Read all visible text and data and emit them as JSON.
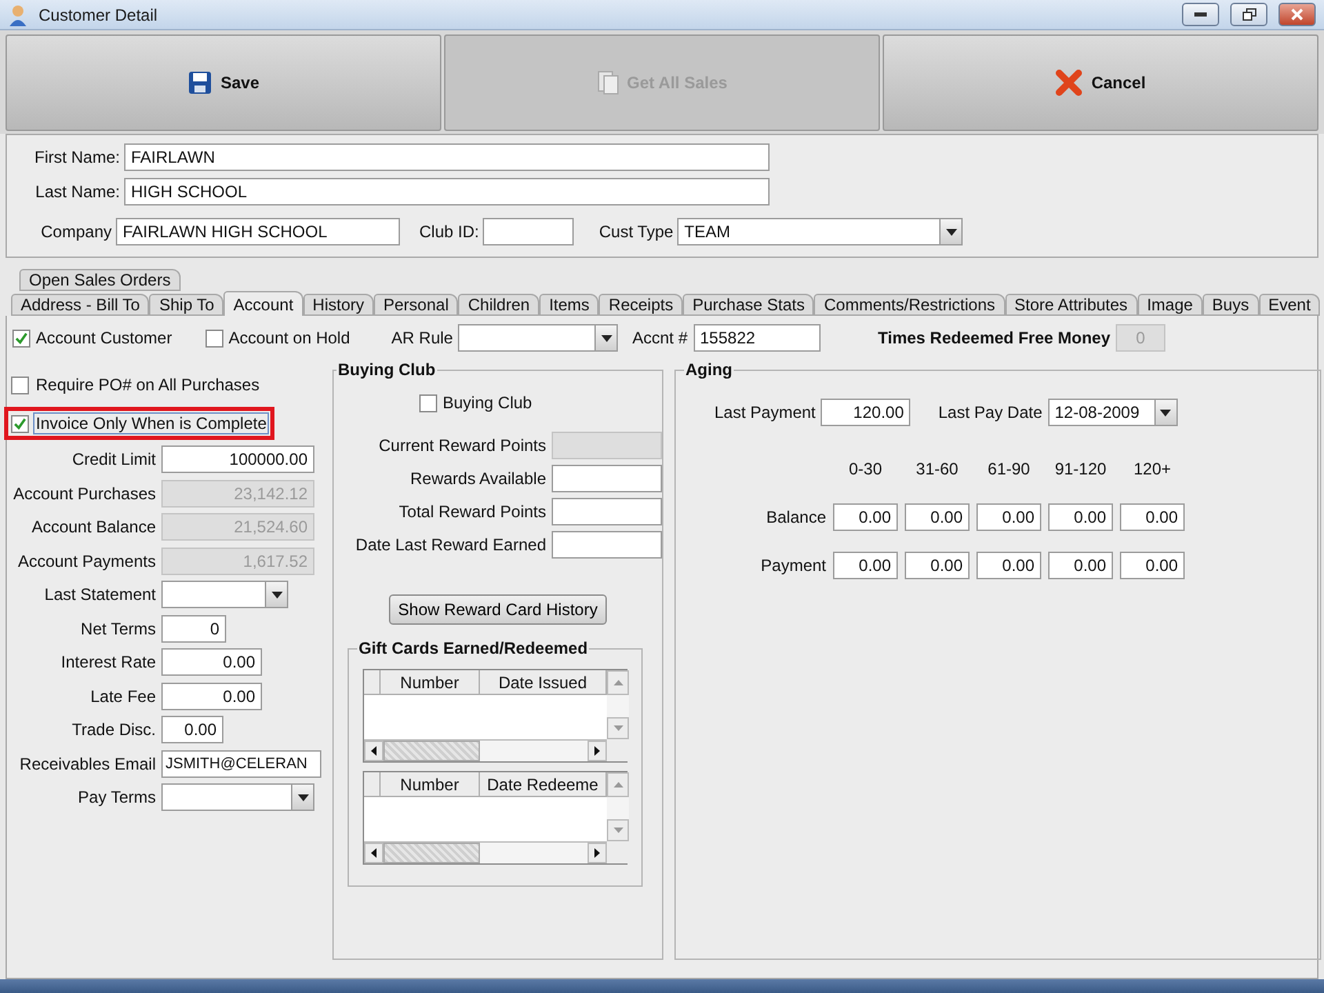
{
  "window": {
    "title": "Customer Detail"
  },
  "toolbar": [
    {
      "label": "Save",
      "disabled": false
    },
    {
      "label": "Get All Sales",
      "disabled": true
    },
    {
      "label": "Cancel",
      "disabled": false
    }
  ],
  "customer": {
    "first_name": {
      "label": "First Name:",
      "value": "FAIRLAWN"
    },
    "last_name": {
      "label": "Last Name:",
      "value": "HIGH SCHOOL"
    },
    "company": {
      "label": "Company",
      "value": "FAIRLAWN HIGH SCHOOL"
    },
    "club_id": {
      "label": "Club ID:"
    },
    "cust_type": {
      "label": "Cust Type",
      "value": "TEAM"
    }
  },
  "tabs": [
    [
      {
        "label": "Open Sales Orders",
        "selected": false
      }
    ],
    [
      {
        "label": "Address - Bill To",
        "selected": false
      },
      {
        "label": "Ship To",
        "selected": false
      },
      {
        "label": "Account",
        "selected": true
      },
      {
        "label": "History",
        "selected": false
      },
      {
        "label": "Personal",
        "selected": false
      },
      {
        "label": "Children",
        "selected": false
      },
      {
        "label": "Items",
        "selected": false
      },
      {
        "label": "Receipts",
        "selected": false
      },
      {
        "label": "Purchase Stats",
        "selected": false
      },
      {
        "label": "Comments/Restrictions",
        "selected": false
      },
      {
        "label": "Store Attributes",
        "selected": false
      },
      {
        "label": "Image",
        "selected": false
      },
      {
        "label": "Buys",
        "selected": false
      },
      {
        "label": "Event",
        "selected": false
      }
    ]
  ],
  "account": {
    "account_customer": {
      "label": "Account Customer",
      "checked": true
    },
    "account_on_hold": {
      "label": "Account on Hold",
      "checked": false
    },
    "ar_rule": {
      "label": "AR Rule"
    },
    "accnt_no": {
      "label": "Accnt #",
      "value": "155822"
    },
    "times_redeemed": {
      "label": "Times Redeemed Free Money",
      "value": "0",
      "disabled": true
    },
    "options": [
      {
        "label": "Require PO# on All Purchases",
        "checked": false,
        "highlighted": false
      },
      {
        "label": "Invoice Only  When is Complete",
        "checked": true,
        "highlighted": true
      }
    ],
    "fields": [
      {
        "label": "Credit Limit",
        "kind": "number",
        "value": "100000.00",
        "disabled": false
      },
      {
        "label": "Account Purchases",
        "kind": "number",
        "value": "23,142.12",
        "disabled": true
      },
      {
        "label": "Account Balance",
        "kind": "number",
        "value": "21,524.60",
        "disabled": true
      },
      {
        "label": "Account Payments",
        "kind": "number",
        "value": "1,617.52",
        "disabled": true
      },
      {
        "label": "Last Statement",
        "kind": "select"
      },
      {
        "label": "Net Terms",
        "kind": "number",
        "value": "0",
        "disabled": false
      },
      {
        "label": "Interest Rate",
        "kind": "number",
        "value": "0.00",
        "disabled": false
      },
      {
        "label": "Late Fee",
        "kind": "number",
        "value": "0.00",
        "disabled": false
      },
      {
        "label": "Trade Disc.",
        "kind": "number",
        "value": "0.00",
        "disabled": false
      },
      {
        "label": "Receivables Email",
        "kind": "text",
        "value": "JSMITH@CELERAN",
        "disabled": false
      },
      {
        "label": "Pay Terms",
        "kind": "select"
      }
    ]
  },
  "buying_club": {
    "title": "Buying Club",
    "checkbox": {
      "label": "Buying Club",
      "checked": false
    },
    "fields": [
      {
        "label": "Current Reward Points",
        "disabled": true
      },
      {
        "label": "Rewards Available",
        "disabled": false
      },
      {
        "label": "Total Reward Points",
        "disabled": false
      },
      {
        "label": "Date Last Reward Earned",
        "disabled": false
      }
    ],
    "history_button": "Show Reward Card History",
    "gift_cards": {
      "title": "Gift Cards Earned/Redeemed",
      "tables": [
        {
          "columns": [
            "Number",
            "Date Issued"
          ]
        },
        {
          "columns": [
            "Number",
            "Date Redeeme"
          ]
        }
      ]
    }
  },
  "aging": {
    "title": "Aging",
    "last_payment": {
      "label": "Last Payment",
      "value": "120.00"
    },
    "last_pay_date": {
      "label": "Last Pay Date",
      "value": "12-08-2009"
    },
    "columns": [
      "0-30",
      "31-60",
      "61-90",
      "91-120",
      "120+"
    ],
    "rows": [
      {
        "label": "Balance",
        "values": [
          "0.00",
          "0.00",
          "0.00",
          "0.00",
          "0.00"
        ]
      },
      {
        "label": "Payment",
        "values": [
          "0.00",
          "0.00",
          "0.00",
          "0.00",
          "0.00"
        ]
      }
    ]
  }
}
